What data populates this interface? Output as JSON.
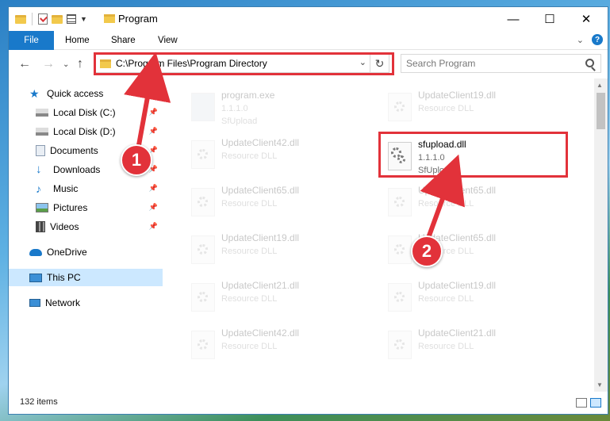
{
  "window": {
    "title": "Program"
  },
  "ribbon": {
    "file": "File",
    "home": "Home",
    "share": "Share",
    "view": "View"
  },
  "address": {
    "path": "C:\\Program Files\\Program Directory"
  },
  "search": {
    "placeholder": "Search Program"
  },
  "sidebar": {
    "items": [
      {
        "label": "Quick access",
        "icon": "star-icon"
      },
      {
        "label": "Local Disk (C:)",
        "icon": "drive-icon"
      },
      {
        "label": "Local Disk (D:)",
        "icon": "drive-icon"
      },
      {
        "label": "Documents",
        "icon": "documents-icon"
      },
      {
        "label": "Downloads",
        "icon": "downloads-icon"
      },
      {
        "label": "Music",
        "icon": "music-icon"
      },
      {
        "label": "Pictures",
        "icon": "pictures-icon"
      },
      {
        "label": "Videos",
        "icon": "videos-icon"
      },
      {
        "label": "OneDrive",
        "icon": "cloud-icon"
      },
      {
        "label": "This PC",
        "icon": "computer-icon"
      },
      {
        "label": "Network",
        "icon": "network-icon"
      }
    ]
  },
  "files": {
    "program": {
      "name": "program.exe",
      "version": "1.1.1.0",
      "company": "SfUpload"
    },
    "highlight": {
      "name": "sfupload.dll",
      "version": "1.1.1.0",
      "company": "SfUpload"
    },
    "left": [
      {
        "name": "UpdateClient42.dll",
        "desc": "Resource DLL"
      },
      {
        "name": "UpdateClient65.dll",
        "desc": "Resource DLL"
      },
      {
        "name": "UpdateClient19.dll",
        "desc": "Resource DLL"
      },
      {
        "name": "UpdateClient21.dll",
        "desc": "Resource DLL"
      },
      {
        "name": "UpdateClient42.dll",
        "desc": "Resource DLL"
      }
    ],
    "right": [
      {
        "name": "UpdateClient19.dll",
        "desc": "Resource DLL"
      },
      {
        "name": "UpdateClient65.dll",
        "desc": "Resource DLL"
      },
      {
        "name": "UpdateClient65.dll",
        "desc": "Resource DLL"
      },
      {
        "name": "UpdateClient19.dll",
        "desc": "Resource DLL"
      },
      {
        "name": "UpdateClient21.dll",
        "desc": "Resource DLL"
      }
    ]
  },
  "status": {
    "items": "132 items"
  },
  "annotations": {
    "step1": "1",
    "step2": "2"
  },
  "colors": {
    "accent": "#1979ca",
    "highlight_red": "#e2323a",
    "selected_bg": "#cce8ff"
  }
}
